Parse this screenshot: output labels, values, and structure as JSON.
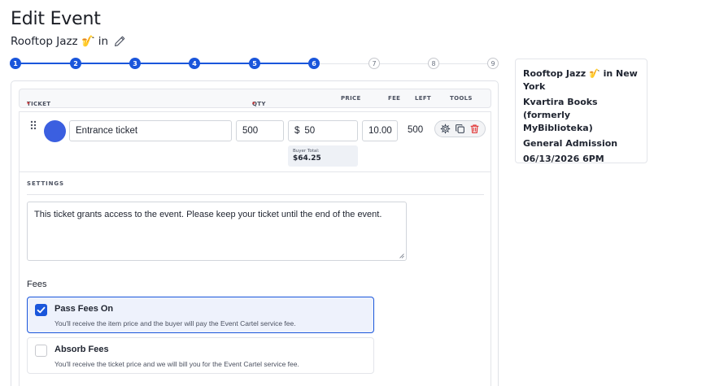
{
  "page": {
    "title": "Edit Event",
    "event_name": "Rooftop Jazz 🎷",
    "event_suffix": "in",
    "edit_icon": "pencil-icon"
  },
  "stepper": {
    "steps": [
      "1",
      "2",
      "3",
      "4",
      "5",
      "6",
      "7",
      "8",
      "9"
    ],
    "current_step": 6,
    "accent": "#1a56db"
  },
  "summary": {
    "event": "Rooftop Jazz 🎷 in New York",
    "venue": "Kvartira Books (formerly MyBiblioteka)",
    "ticket_type": "General Admission",
    "datetime": "06/13/2026 6PM"
  },
  "ticket_table": {
    "headers": {
      "ticket": "TICKET",
      "qty": "QTY",
      "price": "PRICE",
      "fee": "FEE",
      "left": "LEFT",
      "tools": "TOOLS",
      "required_mark": "*"
    },
    "row": {
      "color": "#3b5fe0",
      "name": "Entrance ticket",
      "qty": "500",
      "price_currency": "$",
      "price": "50",
      "fee": "10.00",
      "left": "500",
      "buyer_total_label": "Buyer Total:",
      "buyer_total": "$64.25",
      "tool_icons": [
        "gear-icon",
        "copy-icon",
        "trash-icon"
      ]
    }
  },
  "settings": {
    "label": "SETTINGS",
    "description": "This ticket grants access to the event. Please keep your ticket until the end of the event.",
    "fees_label": "Fees",
    "fee_options": [
      {
        "title": "Pass Fees On",
        "subtitle": "You'll receive the item price and the buyer will pay the Event Cartel service fee.",
        "checked": true
      },
      {
        "title": "Absorb Fees",
        "subtitle": "You'll receive the ticket price and we will bill you for the Event Cartel service fee.",
        "checked": false
      }
    ]
  }
}
